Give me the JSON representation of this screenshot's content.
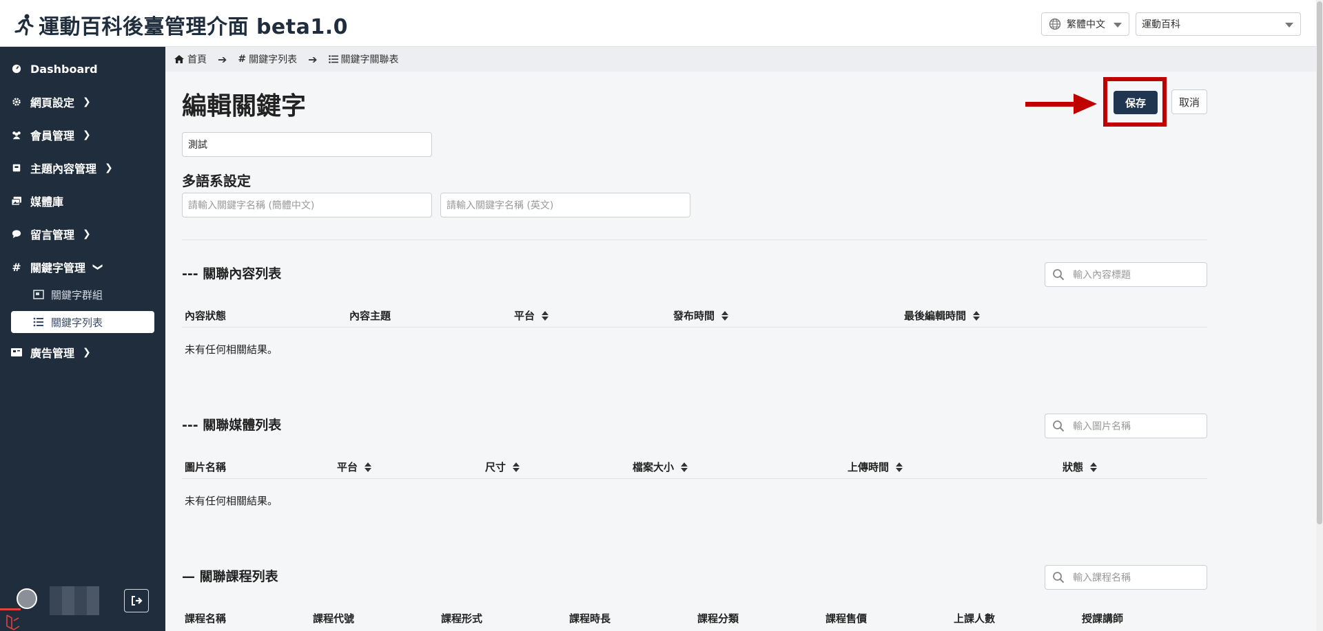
{
  "header": {
    "title": "運動百科後臺管理介面 beta1.0",
    "language": "繁體中文",
    "site": "運動百科"
  },
  "sidebar": {
    "items": [
      {
        "label": "Dashboard"
      },
      {
        "label": "網頁設定"
      },
      {
        "label": "會員管理"
      },
      {
        "label": "主題內容管理"
      },
      {
        "label": "媒體庫"
      },
      {
        "label": "留言管理"
      },
      {
        "label": "關鍵字管理"
      },
      {
        "label": "廣告管理"
      }
    ],
    "sub_items": [
      {
        "label": "關鍵字群組"
      },
      {
        "label": "關鍵字列表"
      }
    ]
  },
  "breadcrumb": {
    "home": "首頁",
    "list": "關鍵字列表",
    "current": "關鍵字關聯表"
  },
  "page": {
    "title": "編輯關鍵字",
    "keyword_value": "測試",
    "multilang_title": "多語系設定",
    "placeholder_zh_cn": "請輸入關鍵字名稱 (簡體中文)",
    "placeholder_en": "請輸入關鍵字名稱 (英文)",
    "save_label": "保存",
    "cancel_label": "取消",
    "annotation_color": "#c00000"
  },
  "content_section": {
    "title": "--- 關聯內容列表",
    "search_placeholder": "輸入內容標題",
    "columns": [
      "內容狀態",
      "內容主題",
      "平台",
      "發布時間",
      "最後編輯時間"
    ],
    "empty": "未有任何相關結果。"
  },
  "media_section": {
    "title": "--- 關聯媒體列表",
    "search_placeholder": "輸入圖片名稱",
    "columns": [
      "圖片名稱",
      "平台",
      "尺寸",
      "檔案大小",
      "上傳時間",
      "狀態"
    ],
    "empty": "未有任何相關結果。"
  },
  "course_section": {
    "title": "— 關聯課程列表",
    "search_placeholder": "輸入課程名稱",
    "columns": [
      "課程名稱",
      "課程代號",
      "課程形式",
      "課程時長",
      "課程分類",
      "課程售價",
      "上課人數",
      "授課講師"
    ]
  }
}
